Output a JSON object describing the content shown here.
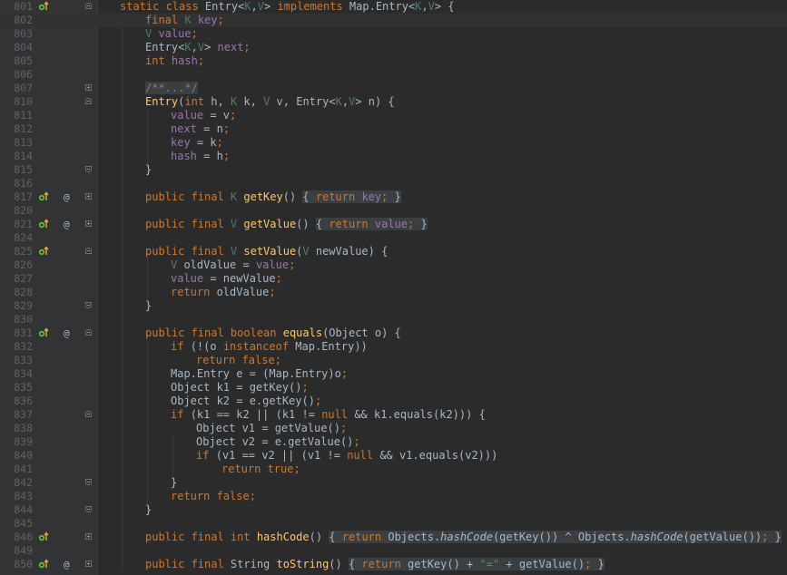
{
  "editor": {
    "caret_line": "802",
    "lines": [
      {
        "n": "801",
        "indent": 0,
        "impl": true,
        "ann": false,
        "fold": "start",
        "segs": [
          [
            "kw",
            "static class "
          ],
          [
            "",
            "Entry<"
          ],
          [
            "tp",
            "K"
          ],
          [
            "",
            ","
          ],
          [
            "tp",
            "V"
          ],
          [
            "",
            "> "
          ],
          [
            "kw",
            "implements "
          ],
          [
            "",
            "Map.Entry<"
          ],
          [
            "tp",
            "K"
          ],
          [
            "",
            ","
          ],
          [
            "tp",
            "V"
          ],
          [
            "",
            "> {"
          ]
        ]
      },
      {
        "n": "802",
        "indent": 1,
        "segs": [
          [
            "kw",
            "final "
          ],
          [
            "tp",
            "K "
          ],
          [
            "fd",
            "key"
          ],
          [
            "kw",
            ";"
          ]
        ]
      },
      {
        "n": "803",
        "indent": 1,
        "segs": [
          [
            "tp",
            "V "
          ],
          [
            "fd",
            "value"
          ],
          [
            "kw",
            ";"
          ]
        ]
      },
      {
        "n": "804",
        "indent": 1,
        "segs": [
          [
            "",
            "Entry<"
          ],
          [
            "tp",
            "K"
          ],
          [
            "",
            ","
          ],
          [
            "tp",
            "V"
          ],
          [
            "",
            "> "
          ],
          [
            "fd",
            "next"
          ],
          [
            "kw",
            ";"
          ]
        ]
      },
      {
        "n": "805",
        "indent": 1,
        "segs": [
          [
            "kw",
            "int "
          ],
          [
            "fd",
            "hash"
          ],
          [
            "kw",
            ";"
          ]
        ]
      },
      {
        "n": "806",
        "indent": 0,
        "segs": []
      },
      {
        "n": "807",
        "indent": 1,
        "fold": "plus",
        "segs": [
          [
            "cm fb",
            "/**...*/"
          ]
        ]
      },
      {
        "n": "810",
        "indent": 1,
        "fold": "start",
        "segs": [
          [
            "fn",
            "Entry"
          ],
          [
            "",
            "("
          ],
          [
            "kw",
            "int "
          ],
          [
            "",
            "h, "
          ],
          [
            "tp",
            "K "
          ],
          [
            "",
            "k, "
          ],
          [
            "tp",
            "V "
          ],
          [
            "",
            "v, Entry<"
          ],
          [
            "tp",
            "K"
          ],
          [
            "",
            ","
          ],
          [
            "tp",
            "V"
          ],
          [
            "",
            "> n) {"
          ]
        ]
      },
      {
        "n": "811",
        "indent": 2,
        "segs": [
          [
            "fd",
            "value "
          ],
          [
            "",
            "= v"
          ],
          [
            "kw",
            ";"
          ]
        ]
      },
      {
        "n": "812",
        "indent": 2,
        "segs": [
          [
            "fd",
            "next "
          ],
          [
            "",
            "= n"
          ],
          [
            "kw",
            ";"
          ]
        ]
      },
      {
        "n": "813",
        "indent": 2,
        "segs": [
          [
            "fd",
            "key "
          ],
          [
            "",
            "= k"
          ],
          [
            "kw",
            ";"
          ]
        ]
      },
      {
        "n": "814",
        "indent": 2,
        "segs": [
          [
            "fd",
            "hash "
          ],
          [
            "",
            "= h"
          ],
          [
            "kw",
            ";"
          ]
        ]
      },
      {
        "n": "815",
        "indent": 1,
        "fold": "end",
        "segs": [
          [
            "",
            "}"
          ]
        ]
      },
      {
        "n": "816",
        "indent": 0,
        "segs": []
      },
      {
        "n": "817",
        "indent": 1,
        "impl": true,
        "ann": true,
        "fold": "plus",
        "segs": [
          [
            "kw",
            "public final "
          ],
          [
            "tp",
            "K "
          ],
          [
            "fn",
            "getKey"
          ],
          [
            "",
            "() "
          ],
          [
            "fb",
            "{ "
          ],
          [
            "kw fb",
            "return "
          ],
          [
            "fd fb",
            "key"
          ],
          [
            "kw fb",
            ";"
          ],
          [
            "fb",
            " }"
          ]
        ]
      },
      {
        "n": "820",
        "indent": 0,
        "segs": []
      },
      {
        "n": "821",
        "indent": 1,
        "impl": true,
        "ann": true,
        "fold": "plus",
        "segs": [
          [
            "kw",
            "public final "
          ],
          [
            "tp",
            "V "
          ],
          [
            "fn",
            "getValue"
          ],
          [
            "",
            "() "
          ],
          [
            "fb",
            "{ "
          ],
          [
            "kw fb",
            "return "
          ],
          [
            "fd fb",
            "value"
          ],
          [
            "kw fb",
            ";"
          ],
          [
            "fb",
            " }"
          ]
        ]
      },
      {
        "n": "824",
        "indent": 0,
        "segs": []
      },
      {
        "n": "825",
        "indent": 1,
        "impl": true,
        "fold": "start",
        "segs": [
          [
            "kw",
            "public final "
          ],
          [
            "tp",
            "V "
          ],
          [
            "fn",
            "setValue"
          ],
          [
            "",
            "("
          ],
          [
            "tp",
            "V "
          ],
          [
            "",
            "newValue) {"
          ]
        ]
      },
      {
        "n": "826",
        "indent": 2,
        "segs": [
          [
            "tp",
            "V "
          ],
          [
            "",
            "oldValue = "
          ],
          [
            "fd",
            "value"
          ],
          [
            "kw",
            ";"
          ]
        ]
      },
      {
        "n": "827",
        "indent": 2,
        "segs": [
          [
            "fd",
            "value "
          ],
          [
            "",
            "= newValue"
          ],
          [
            "kw",
            ";"
          ]
        ]
      },
      {
        "n": "828",
        "indent": 2,
        "segs": [
          [
            "kw",
            "return "
          ],
          [
            "",
            "oldValue"
          ],
          [
            "kw",
            ";"
          ]
        ]
      },
      {
        "n": "829",
        "indent": 1,
        "fold": "end",
        "segs": [
          [
            "",
            "}"
          ]
        ]
      },
      {
        "n": "830",
        "indent": 0,
        "segs": []
      },
      {
        "n": "831",
        "indent": 1,
        "impl": true,
        "ann": true,
        "fold": "start",
        "segs": [
          [
            "kw",
            "public final boolean "
          ],
          [
            "fn",
            "equals"
          ],
          [
            "",
            "(Object o) {"
          ]
        ]
      },
      {
        "n": "832",
        "indent": 2,
        "segs": [
          [
            "kw",
            "if "
          ],
          [
            "",
            "(!(o "
          ],
          [
            "kw",
            "instanceof "
          ],
          [
            "",
            "Map.Entry))"
          ]
        ]
      },
      {
        "n": "833",
        "indent": 3,
        "segs": [
          [
            "kw",
            "return false;"
          ]
        ]
      },
      {
        "n": "834",
        "indent": 2,
        "segs": [
          [
            "",
            "Map.Entry e = (Map.Entry)o"
          ],
          [
            "kw",
            ";"
          ]
        ]
      },
      {
        "n": "835",
        "indent": 2,
        "segs": [
          [
            "",
            "Object k1 = getKey()"
          ],
          [
            "kw",
            ";"
          ]
        ]
      },
      {
        "n": "836",
        "indent": 2,
        "segs": [
          [
            "",
            "Object k2 = e.getKey()"
          ],
          [
            "kw",
            ";"
          ]
        ]
      },
      {
        "n": "837",
        "indent": 2,
        "fold": "start",
        "segs": [
          [
            "kw",
            "if "
          ],
          [
            "",
            "(k1 == k2 || (k1 != "
          ],
          [
            "kw",
            "null "
          ],
          [
            "",
            "&& k1.equals(k2))) {"
          ]
        ]
      },
      {
        "n": "838",
        "indent": 3,
        "segs": [
          [
            "",
            "Object v1 = getValue()"
          ],
          [
            "kw",
            ";"
          ]
        ]
      },
      {
        "n": "839",
        "indent": 3,
        "segs": [
          [
            "",
            "Object v2 = e.getValue()"
          ],
          [
            "kw",
            ";"
          ]
        ]
      },
      {
        "n": "840",
        "indent": 3,
        "segs": [
          [
            "kw",
            "if "
          ],
          [
            "",
            "(v1 == v2 || (v1 != "
          ],
          [
            "kw",
            "null "
          ],
          [
            "",
            "&& v1.equals(v2)))"
          ]
        ]
      },
      {
        "n": "841",
        "indent": 4,
        "segs": [
          [
            "kw",
            "return true;"
          ]
        ]
      },
      {
        "n": "842",
        "indent": 2,
        "fold": "end",
        "segs": [
          [
            "",
            "}"
          ]
        ]
      },
      {
        "n": "843",
        "indent": 2,
        "segs": [
          [
            "kw",
            "return false;"
          ]
        ]
      },
      {
        "n": "844",
        "indent": 1,
        "fold": "end",
        "segs": [
          [
            "",
            "}"
          ]
        ]
      },
      {
        "n": "845",
        "indent": 0,
        "segs": []
      },
      {
        "n": "846",
        "indent": 1,
        "impl": true,
        "fold": "plus",
        "segs": [
          [
            "kw",
            "public final int "
          ],
          [
            "fn",
            "hashCode"
          ],
          [
            "",
            "() "
          ],
          [
            "fb",
            "{ "
          ],
          [
            "kw fb",
            "return "
          ],
          [
            "fb",
            "Objects."
          ],
          [
            "it fb",
            "hashCode"
          ],
          [
            "fb",
            "(getKey()) ^ Objects."
          ],
          [
            "it fb",
            "hashCode"
          ],
          [
            "fb",
            "(getValue())"
          ],
          [
            "kw fb",
            ";"
          ],
          [
            "fb",
            " }"
          ]
        ]
      },
      {
        "n": "849",
        "indent": 0,
        "segs": []
      },
      {
        "n": "850",
        "indent": 1,
        "impl": true,
        "ann": true,
        "fold": "plus",
        "segs": [
          [
            "kw",
            "public final "
          ],
          [
            "",
            "String "
          ],
          [
            "fn",
            "toString"
          ],
          [
            "",
            "() "
          ],
          [
            "fb",
            "{ "
          ],
          [
            "kw fb",
            "return "
          ],
          [
            "fb",
            "getKey() + "
          ],
          [
            "st fb",
            "\"=\""
          ],
          [
            "fb",
            " + getValue()"
          ],
          [
            "kw fb",
            ";"
          ],
          [
            "fb",
            " }"
          ]
        ]
      }
    ]
  }
}
